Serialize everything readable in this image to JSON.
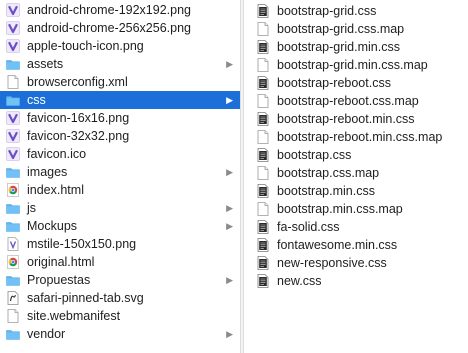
{
  "colors": {
    "selection": "#1c6fd8",
    "folder": "#5fb4f0",
    "vs_icon": "#6c4fc4",
    "chrome_red": "#db4437",
    "chrome_yellow": "#f4c20d",
    "chrome_green": "#0f9d58",
    "chrome_blue": "#4285f4"
  },
  "left_column": {
    "items": [
      {
        "name": "android-chrome-192x192.png",
        "icon": "vs-icon",
        "folder": false
      },
      {
        "name": "android-chrome-256x256.png",
        "icon": "vs-icon",
        "folder": false
      },
      {
        "name": "apple-touch-icon.png",
        "icon": "vs-icon",
        "folder": false
      },
      {
        "name": "assets",
        "icon": "folder-icon",
        "folder": true
      },
      {
        "name": "browserconfig.xml",
        "icon": "document-icon",
        "folder": false
      },
      {
        "name": "css",
        "icon": "folder-icon",
        "folder": true,
        "selected": true
      },
      {
        "name": "favicon-16x16.png",
        "icon": "vs-icon",
        "folder": false
      },
      {
        "name": "favicon-32x32.png",
        "icon": "vs-icon",
        "folder": false
      },
      {
        "name": "favicon.ico",
        "icon": "vs-icon",
        "folder": false
      },
      {
        "name": "images",
        "icon": "folder-icon",
        "folder": true
      },
      {
        "name": "index.html",
        "icon": "chrome-icon",
        "folder": false
      },
      {
        "name": "js",
        "icon": "folder-icon",
        "folder": true
      },
      {
        "name": "Mockups",
        "icon": "folder-icon",
        "folder": true
      },
      {
        "name": "mstile-150x150.png",
        "icon": "image-file-icon",
        "folder": false
      },
      {
        "name": "original.html",
        "icon": "chrome-icon",
        "folder": false
      },
      {
        "name": "Propuestas",
        "icon": "folder-icon",
        "folder": true
      },
      {
        "name": "safari-pinned-tab.svg",
        "icon": "svg-file-icon",
        "folder": false
      },
      {
        "name": "site.webmanifest",
        "icon": "document-icon",
        "folder": false
      },
      {
        "name": "vendor",
        "icon": "folder-icon",
        "folder": true
      }
    ]
  },
  "right_column": {
    "items": [
      {
        "name": "bootstrap-grid.css",
        "icon": "css-file-icon"
      },
      {
        "name": "bootstrap-grid.css.map",
        "icon": "document-icon"
      },
      {
        "name": "bootstrap-grid.min.css",
        "icon": "css-file-icon"
      },
      {
        "name": "bootstrap-grid.min.css.map",
        "icon": "document-icon"
      },
      {
        "name": "bootstrap-reboot.css",
        "icon": "css-file-icon"
      },
      {
        "name": "bootstrap-reboot.css.map",
        "icon": "document-icon"
      },
      {
        "name": "bootstrap-reboot.min.css",
        "icon": "css-file-icon"
      },
      {
        "name": "bootstrap-reboot.min.css.map",
        "icon": "document-icon"
      },
      {
        "name": "bootstrap.css",
        "icon": "css-file-icon"
      },
      {
        "name": "bootstrap.css.map",
        "icon": "document-icon"
      },
      {
        "name": "bootstrap.min.css",
        "icon": "css-file-icon"
      },
      {
        "name": "bootstrap.min.css.map",
        "icon": "document-icon"
      },
      {
        "name": "fa-solid.css",
        "icon": "css-file-icon"
      },
      {
        "name": "fontawesome.min.css",
        "icon": "css-file-icon"
      },
      {
        "name": "new-responsive.css",
        "icon": "css-file-icon"
      },
      {
        "name": "new.css",
        "icon": "css-file-icon"
      }
    ]
  }
}
